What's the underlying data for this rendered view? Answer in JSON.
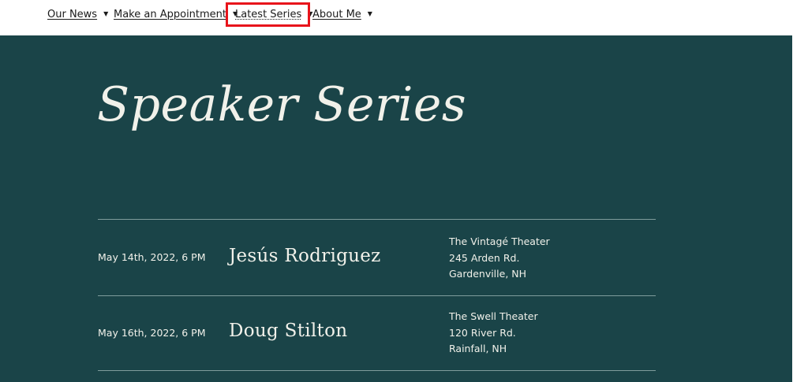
{
  "nav": {
    "items": [
      {
        "label": "Our News"
      },
      {
        "label": "Make an Appointment"
      },
      {
        "label": "Latest Series"
      },
      {
        "label": "About Me"
      }
    ],
    "caret": "▼"
  },
  "hero": {
    "title": "Speaker Series"
  },
  "events": [
    {
      "date": "May 14th, 2022, 6 PM",
      "speaker": "Jesús Rodriguez",
      "venue": "The Vintagé Theater",
      "address": "245 Arden Rd.",
      "city": "Gardenville, NH"
    },
    {
      "date": "May 16th, 2022, 6 PM",
      "speaker": "Doug Stilton",
      "venue": "The Swell Theater",
      "address": "120 River Rd.",
      "city": "Rainfall, NH"
    }
  ],
  "colors": {
    "hero_background": "#1a4448",
    "hero_text": "#f1f1ea",
    "highlight": "#e8141b"
  }
}
